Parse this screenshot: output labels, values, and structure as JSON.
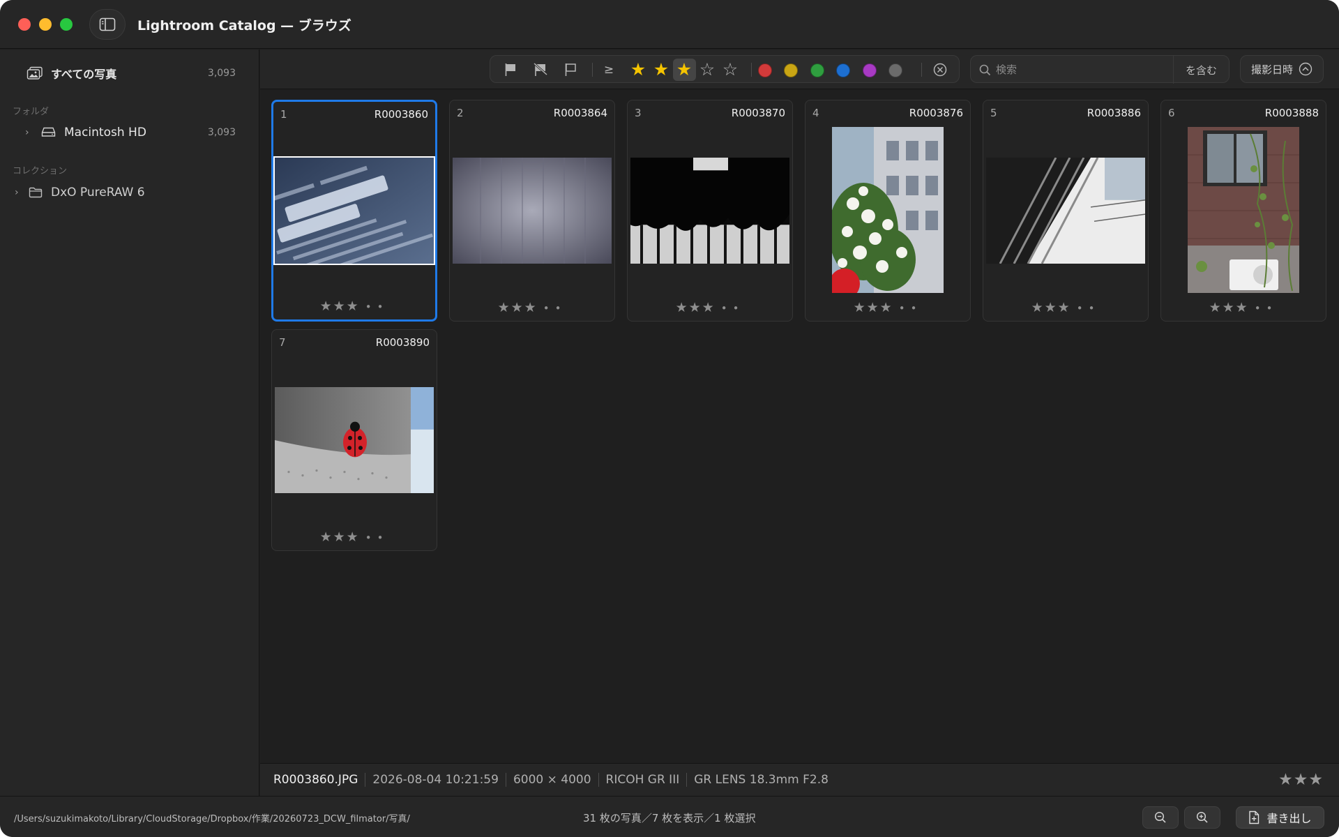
{
  "window": {
    "title": "Lightroom Catalog — ブラウズ"
  },
  "sidebar": {
    "all_photos": {
      "label": "すべての写真",
      "count": "3,093",
      "icon": "photos-icon"
    },
    "folders_section": "フォルダ",
    "folders": [
      {
        "label": "Macintosh HD",
        "count": "3,093",
        "icon": "drive-icon"
      }
    ],
    "collections_section": "コレクション",
    "collections": [
      {
        "label": "DxO PureRAW 6",
        "icon": "folder-icon"
      }
    ]
  },
  "filterbar": {
    "flags": [
      "flag-filled-icon",
      "flag-rejected-icon",
      "flag-outline-icon"
    ],
    "rating_operator": "≥",
    "rating_filter": {
      "active_stars": 3,
      "max_stars": 5
    },
    "color_labels": [
      {
        "name": "red",
        "color": "#d23a3a"
      },
      {
        "name": "yellow",
        "color": "#c9a514"
      },
      {
        "name": "green",
        "color": "#2f9e3f"
      },
      {
        "name": "blue",
        "color": "#1d6fd1"
      },
      {
        "name": "purple",
        "color": "#a83ac4"
      },
      {
        "name": "gray",
        "color": "#6b6b6b"
      }
    ],
    "search_placeholder": "検索",
    "search_value": "",
    "match_mode": "を含む",
    "sort_label": "撮影日時"
  },
  "photos": [
    {
      "index": "1",
      "name": "R0003860",
      "rating": 3,
      "selected": true,
      "orientation": "landscape"
    },
    {
      "index": "2",
      "name": "R0003864",
      "rating": 3,
      "selected": false,
      "orientation": "landscape"
    },
    {
      "index": "3",
      "name": "R0003870",
      "rating": 3,
      "selected": false,
      "orientation": "landscape"
    },
    {
      "index": "4",
      "name": "R0003876",
      "rating": 3,
      "selected": false,
      "orientation": "portrait"
    },
    {
      "index": "5",
      "name": "R0003886",
      "rating": 3,
      "selected": false,
      "orientation": "landscape"
    },
    {
      "index": "6",
      "name": "R0003888",
      "rating": 3,
      "selected": false,
      "orientation": "portrait"
    },
    {
      "index": "7",
      "name": "R0003890",
      "rating": 3,
      "selected": false,
      "orientation": "landscape"
    }
  ],
  "infobar": {
    "filename": "R0003860.JPG",
    "datetime": "2026-08-04 10:21:59",
    "dimensions": "6000 × 4000",
    "camera": "RICOH GR III",
    "lens": "GR LENS 18.3mm F2.8",
    "rating": 3
  },
  "statusbar": {
    "path": "/Users/suzukimakoto/Library/CloudStorage/Dropbox/作業/20260723_DCW_filmator/写真/",
    "count": "31 枚の写真／7 枚を表示／1 枚選択",
    "zoom_out_icon": "zoom-out-icon",
    "zoom_in_icon": "zoom-in-icon",
    "export_label": "書き出し"
  },
  "colors": {
    "accent": "#1f7ae8",
    "star_active": "#f5c400",
    "background": "#1f1f1f"
  }
}
